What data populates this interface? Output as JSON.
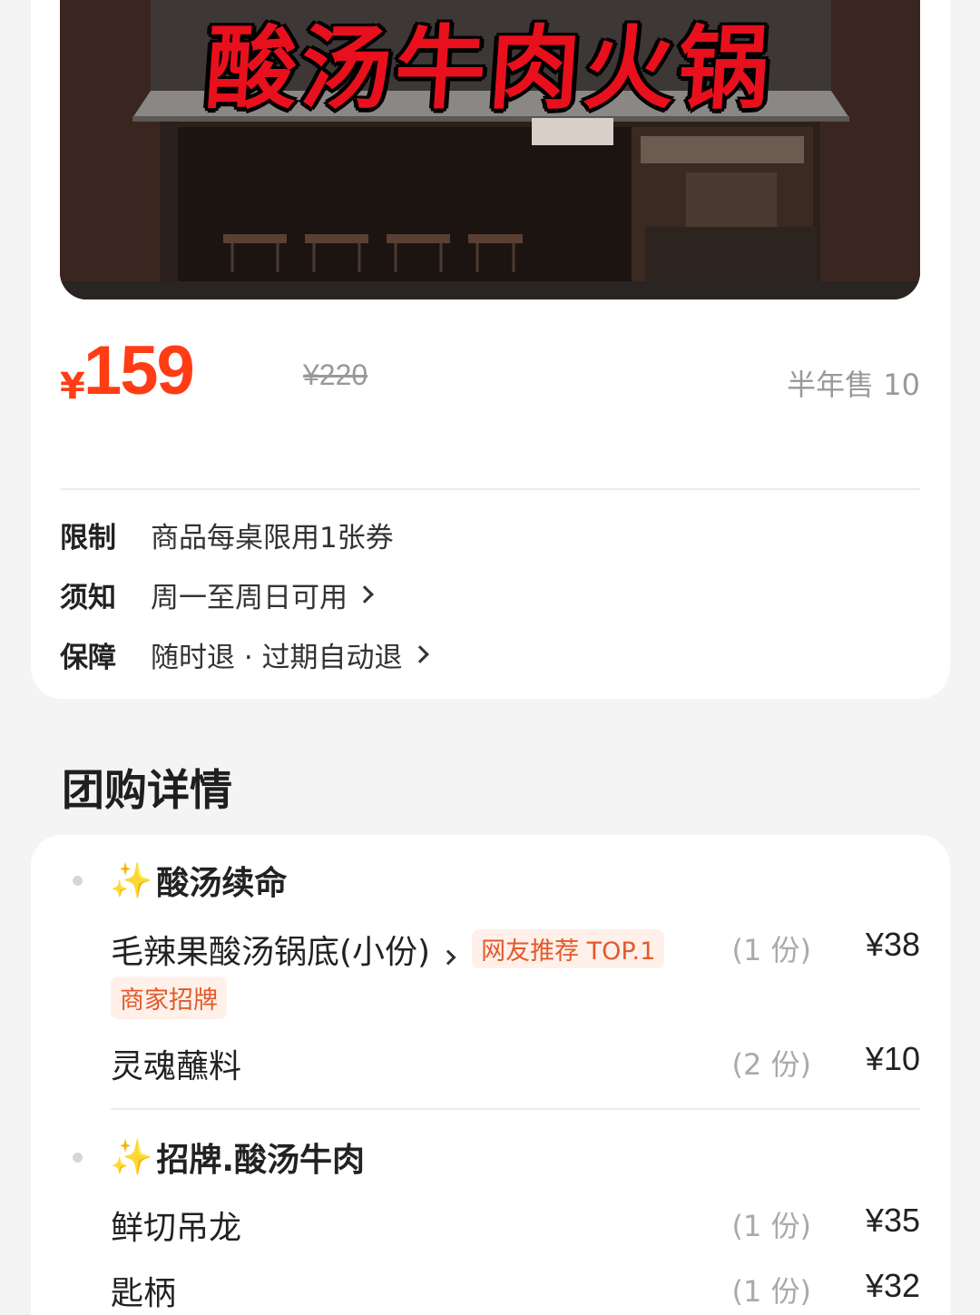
{
  "hero": {
    "sign": "酸汤牛肉火锅"
  },
  "price": {
    "currency": "¥",
    "current": "159",
    "original": "¥220",
    "sold": "半年售 10"
  },
  "info": [
    {
      "label": "限制",
      "text": "商品每桌限用1张券",
      "has_chevron": false
    },
    {
      "label": "须知",
      "text": "周一至周日可用",
      "has_chevron": true
    },
    {
      "label": "保障",
      "text": "随时退 · 过期自动退",
      "has_chevron": true
    }
  ],
  "details": {
    "title": "团购详情",
    "groups": [
      {
        "icon": "sparkles-icon",
        "name": "酸汤续命",
        "items": [
          {
            "name": "毛辣果酸汤锅底(小份)",
            "qty": "(1 份)",
            "price": "¥38",
            "tags": [
              "网友推荐 TOP.1",
              "商家招牌"
            ]
          },
          {
            "name": "灵魂蘸料",
            "qty": "(2 份)",
            "price": "¥10"
          }
        ]
      },
      {
        "icon": "sparkles-icon",
        "name": "招牌.酸汤牛肉",
        "items": [
          {
            "name": "鲜切吊龙",
            "qty": "(1 份)",
            "price": "¥35"
          },
          {
            "name": "匙柄",
            "qty": "(1 份)",
            "price": "¥32"
          }
        ]
      }
    ]
  },
  "colors": {
    "price": "#ff3c14",
    "sign": "#e8101d",
    "tag_bg": "#fff0ea",
    "tag_text": "#e35a2a",
    "sparkle": "#f5b800"
  }
}
